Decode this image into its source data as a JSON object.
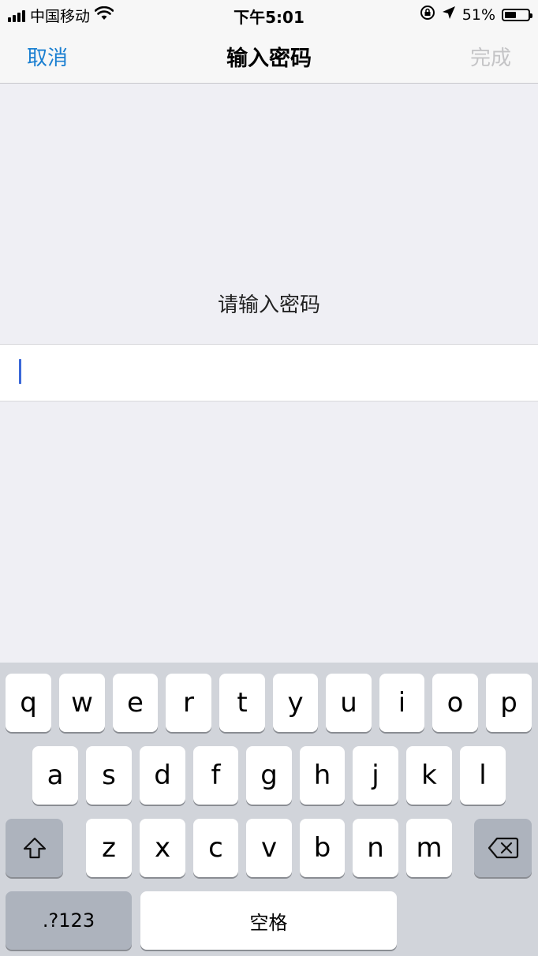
{
  "status_bar": {
    "carrier": "中国移动",
    "time": "下午5:01",
    "battery": "51%",
    "battery_level": 0.51,
    "icons": [
      "signal-bars-icon",
      "wifi-icon",
      "orientation-lock-icon",
      "location-arrow-icon",
      "battery-icon"
    ]
  },
  "navbar": {
    "cancel_label": "取消",
    "title": "输入密码",
    "done_label": "完成"
  },
  "content": {
    "prompt": "请输入密码",
    "password_value": ""
  },
  "keyboard": {
    "row1": [
      "q",
      "w",
      "e",
      "r",
      "t",
      "y",
      "u",
      "i",
      "o",
      "p"
    ],
    "row2": [
      "a",
      "s",
      "d",
      "f",
      "g",
      "h",
      "j",
      "k",
      "l"
    ],
    "row3": [
      "z",
      "x",
      "c",
      "v",
      "b",
      "n",
      "m"
    ],
    "mode_label": ".?123",
    "space_label": "空格",
    "icons": [
      "shift-icon",
      "backspace-icon"
    ]
  },
  "colors": {
    "accent": "#1a7fd1",
    "disabled": "#c4c4c6",
    "background": "#efeff4",
    "keyboard": "#d1d4da",
    "caret": "#3b68d8"
  }
}
